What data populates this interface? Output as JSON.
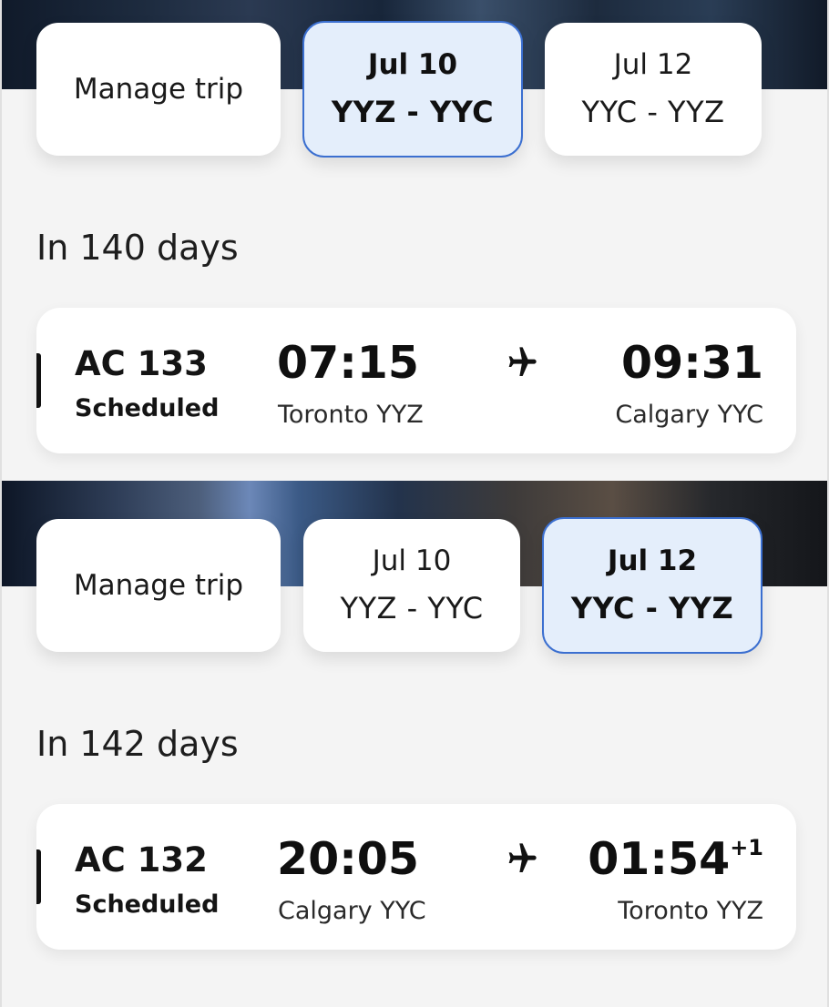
{
  "panels": [
    {
      "tabs": {
        "manage_label": "Manage trip",
        "outbound": {
          "date": "Jul 10",
          "route": "YYZ - YYC"
        },
        "return": {
          "date": "Jul 12",
          "route": "YYC - YYZ"
        },
        "active": "outbound"
      },
      "countdown": "In 140 days",
      "flight": {
        "number": "AC 133",
        "status": "Scheduled",
        "departure_time": "07:15",
        "departure_city": "Toronto YYZ",
        "arrival_time": "09:31",
        "arrival_day_offset": "",
        "arrival_city": "Calgary YYC",
        "icon": "airplane-icon"
      }
    },
    {
      "tabs": {
        "manage_label": "Manage trip",
        "outbound": {
          "date": "Jul 10",
          "route": "YYZ - YYC"
        },
        "return": {
          "date": "Jul 12",
          "route": "YYC - YYZ"
        },
        "active": "return"
      },
      "countdown": "In 142 days",
      "flight": {
        "number": "AC 132",
        "status": "Scheduled",
        "departure_time": "20:05",
        "departure_city": "Calgary YYC",
        "arrival_time": "01:54",
        "arrival_day_offset": "+1",
        "arrival_city": "Toronto YYZ",
        "icon": "airplane-icon"
      }
    }
  ],
  "colors": {
    "active_tab_bg": "#e4eefb",
    "active_tab_border": "#3b6fd0",
    "card_bg": "#ffffff",
    "page_bg": "#f4f4f4"
  }
}
